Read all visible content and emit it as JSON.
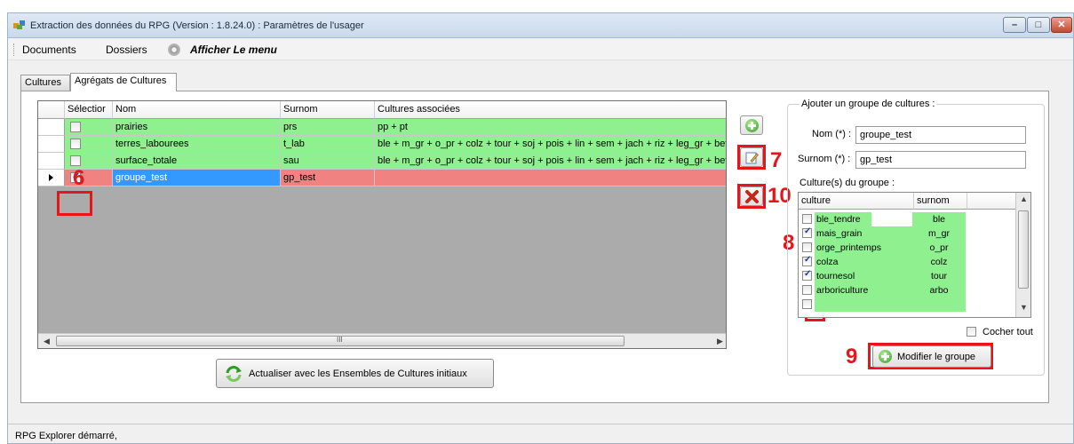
{
  "window": {
    "title": "Extraction des données du RPG (Version : 1.8.24.0) : Paramètres de l'usager",
    "controls": [
      "minimize-icon",
      "maximize-icon",
      "close-icon"
    ]
  },
  "menu": {
    "documents": "Documents",
    "dossiers": "Dossiers",
    "afficher": "Afficher Le menu"
  },
  "tabs": [
    "Cultures",
    "Agrégats de Cultures"
  ],
  "grid": {
    "columns": [
      "Sélectior",
      "Nom",
      "Surnom",
      "Cultures associées"
    ],
    "rows": [
      {
        "checked": false,
        "nom": "prairies",
        "surnom": "prs",
        "cultures": "pp + pt",
        "state": "green"
      },
      {
        "checked": false,
        "nom": "terres_labourees",
        "surnom": "t_lab",
        "cultures": "ble + m_gr + o_pr + colz + tour + soj + pois + lin + sem + jach + riz + leg_gr + bett",
        "state": "green"
      },
      {
        "checked": false,
        "nom": "surface_totale",
        "surnom": "sau",
        "cultures": "ble + m_gr + o_pr + colz + tour + soj + pois + lin + sem + jach + riz + leg_gr + bett",
        "state": "green"
      },
      {
        "checked": true,
        "nom": "groupe_test",
        "surnom": "gp_test",
        "cultures": "",
        "state": "red"
      }
    ],
    "hscroll_grip": "III"
  },
  "refresh_button": "Actualiser avec les Ensembles de Cultures initiaux",
  "group_panel": {
    "legend": "Ajouter un groupe de cultures :",
    "nom_label": "Nom (*) :",
    "nom_value": "groupe_test",
    "surnom_label": "Surnom (*) :",
    "surnom_value": "gp_test",
    "cultures_label": "Culture(s) du groupe :",
    "columns": [
      "culture",
      "surnom"
    ],
    "cultures": [
      {
        "checked": false,
        "culture": "ble_tendre",
        "surnom": "ble"
      },
      {
        "checked": true,
        "culture": "mais_grain",
        "surnom": "m_gr"
      },
      {
        "checked": false,
        "culture": "orge_printemps",
        "surnom": "o_pr"
      },
      {
        "checked": true,
        "culture": "colza",
        "surnom": "colz"
      },
      {
        "checked": true,
        "culture": "tournesol",
        "surnom": "tour"
      },
      {
        "checked": false,
        "culture": "arboriculture",
        "surnom": "arbo"
      }
    ],
    "cocher_tout": "Cocher tout",
    "modify_button": "Modifier le groupe"
  },
  "annotations": [
    "6",
    "7",
    "8",
    "9",
    "10"
  ],
  "status": "RPG Explorer démarré,",
  "colors": {
    "ok_row": "#8ef08e",
    "selected": "#3399ff",
    "invalid_row": "#f08282",
    "annotation": "#e8141b"
  }
}
